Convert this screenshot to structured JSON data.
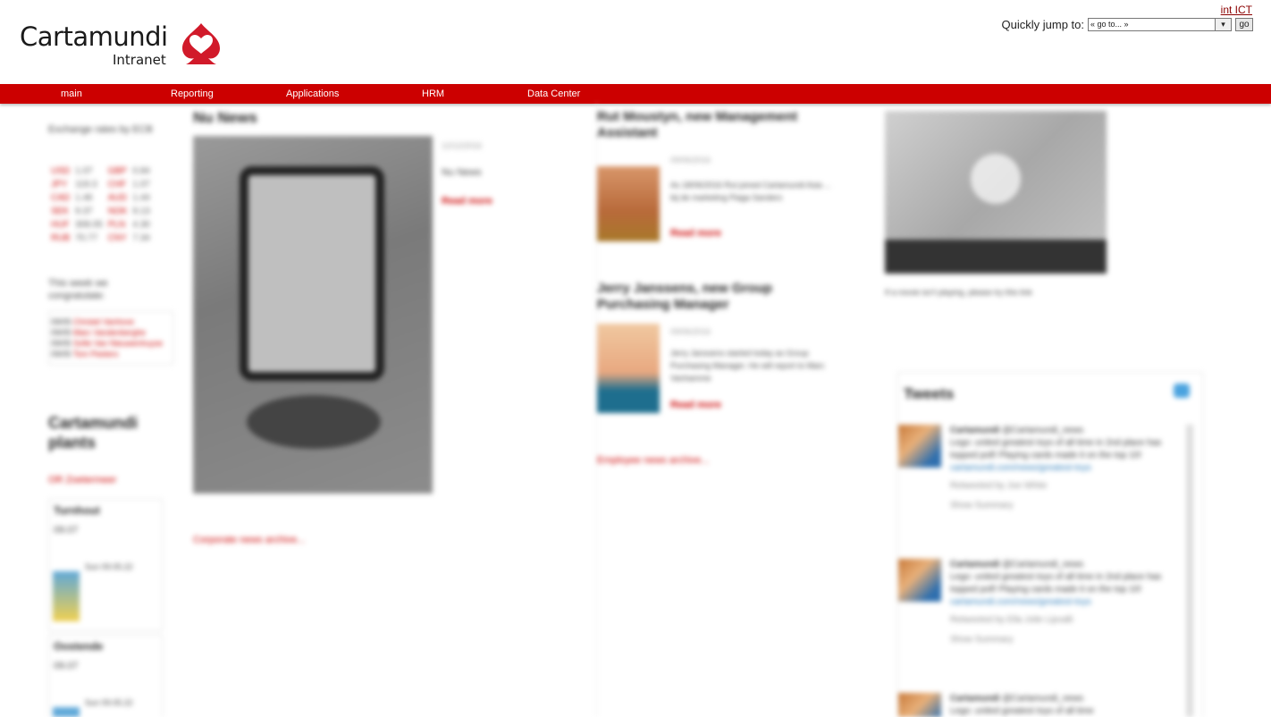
{
  "brand": {
    "name": "Cartamundi",
    "sub": "Intranet",
    "brand_color": "#cc0000"
  },
  "header": {
    "top_link": "int ICT",
    "jump_label": "Quickly jump to:",
    "jump_value": "« go to... »",
    "go_label": "go"
  },
  "nav": {
    "items": [
      "main",
      "Reporting",
      "Applications",
      "HRM",
      "Data Center"
    ]
  },
  "sidebar": {
    "rates_title": "Exchange rates by ECB",
    "rates": [
      [
        "USD",
        "1.07",
        "GBP",
        "0.84"
      ],
      [
        "JPY",
        "119.3",
        "CHF",
        "1.07"
      ],
      [
        "CAD",
        "1.46",
        "AUD",
        "1.44"
      ],
      [
        "SEK",
        "9.37",
        "NOK",
        "9.13"
      ],
      [
        "HUF",
        "308.05",
        "PLN",
        "4.30"
      ],
      [
        "RUB",
        "70.77",
        "CNY",
        "7.34"
      ]
    ],
    "congrats_title": "This week we congratulate:",
    "congrats": [
      [
        "09/05",
        "Christel Vanhove"
      ],
      [
        "09/05",
        "Marc Vandenberghe"
      ],
      [
        "09/05",
        "Sofie Van Nieuwenhuyse"
      ],
      [
        "09/05",
        "Tom Peeters"
      ]
    ],
    "plants_title": "Cartamundi plants",
    "plants_link": "OR Zoetermeer",
    "weather": [
      {
        "city": "Turnhout",
        "date": "09.07",
        "info": "Sun 09.05.22"
      },
      {
        "city": "Oostende",
        "date": "09.07",
        "info": "Sun 09.05.22"
      }
    ]
  },
  "news": {
    "title": "Nu News",
    "date": "12/12/2016",
    "text": "Nu News",
    "read_more": "Read more",
    "more_link": "Corporate news archive..."
  },
  "profiles": {
    "items": [
      {
        "title": "Rut Moustyn, new Management Assistant",
        "date": "09/06/2016",
        "text": "As 18/06/2016 Rut joined Cartamundi Asia ... bij de marketing Piaga Sanders",
        "read_more": "Read more"
      },
      {
        "title": "Jerry Janssens, new Group Purchasing Manager",
        "date": "09/06/2016",
        "text": "Jerry Janssens started today as Group Purchasing Manager. He will report to Marc Vanhamme",
        "read_more": "Read more"
      }
    ],
    "more_link": "Employee news archive..."
  },
  "video": {
    "caption": "If a movie isn't playing, please try this link"
  },
  "tweets": {
    "title": "Tweets",
    "items": [
      {
        "name": "Cartamundi",
        "handle": "@Cartamundi_news",
        "text": "Lego: united greatest toys of all time in 2nd place has topped poll! Playing cards made it on the top 10!",
        "link": "cartamundi.com/news/greatest-toys",
        "meta": "Retweeted by Joe White",
        "footer": "Show Summary"
      },
      {
        "name": "Cartamundi",
        "handle": "@Cartamundi_news",
        "text": "Lego: united greatest toys of all time in 2nd place has topped poll! Playing cards made it on the top 10!",
        "link": "cartamundi.com/news/greatest-toys",
        "meta": "Retweeted by Ella Jolie Lipvalli",
        "footer": "Show Summary"
      },
      {
        "name": "Cartamundi",
        "handle": "@Cartamundi_news",
        "text": "Lego: united greatest toys of all time",
        "link": "",
        "meta": "",
        "footer": ""
      }
    ]
  }
}
